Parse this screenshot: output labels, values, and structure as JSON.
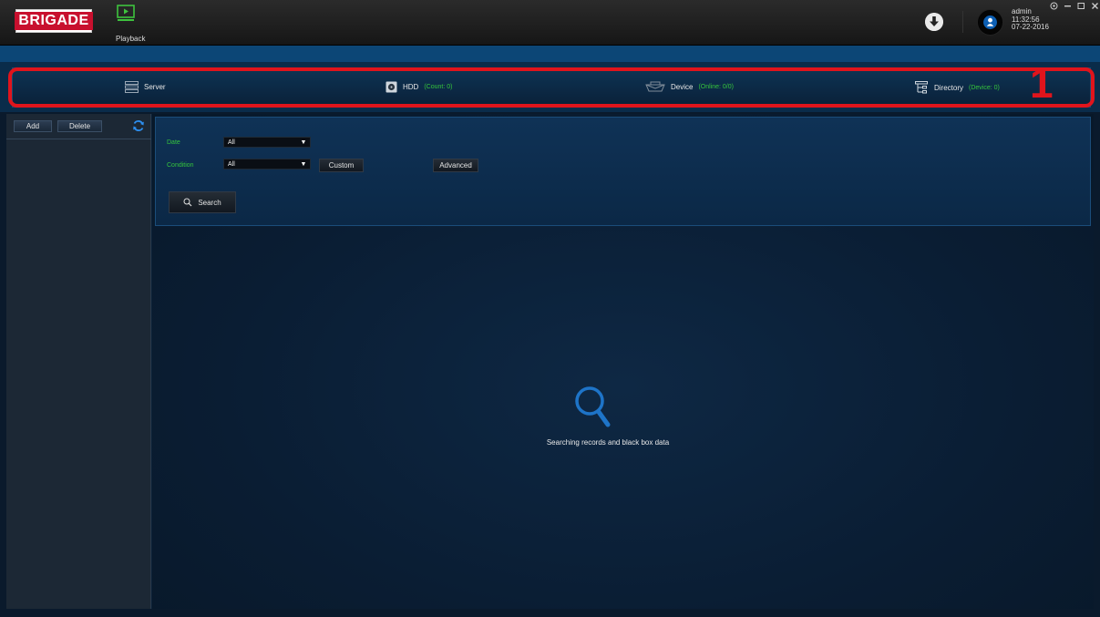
{
  "app": {
    "brand": "BRIGADE",
    "module_label": "Playback"
  },
  "user": {
    "name": "admin",
    "time": "11:32:56",
    "date": "07-22-2016"
  },
  "stats": {
    "server": {
      "label": "Server"
    },
    "hdd": {
      "label": "HDD",
      "count": "(Count: 0)"
    },
    "device": {
      "label": "Device",
      "count": "(Online: 0/0)"
    },
    "directory": {
      "label": "Directory",
      "count": "(Device: 0)"
    }
  },
  "annotation": {
    "callout": "1"
  },
  "left_panel": {
    "add_label": "Add",
    "delete_label": "Delete"
  },
  "filters": {
    "date_label": "Date",
    "date_value": "All",
    "condition_label": "Condition",
    "condition_value": "All",
    "custom_label": "Custom",
    "advanced_label": "Advanced",
    "search_label": "Search"
  },
  "empty_state": {
    "message": "Searching records and black box data"
  },
  "colors": {
    "accent_green": "#35c43d",
    "highlight_red": "#e0141c",
    "brand_red": "#c8102e"
  }
}
